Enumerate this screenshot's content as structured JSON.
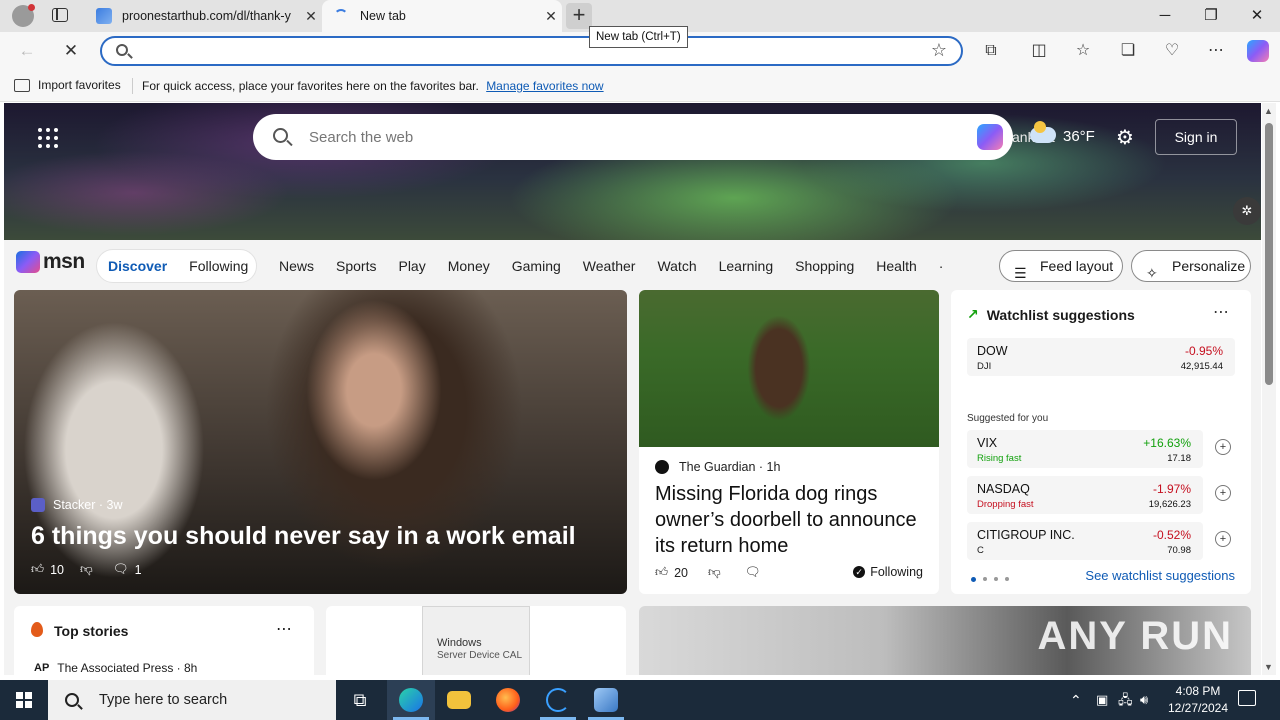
{
  "browser": {
    "tabs": [
      {
        "title": "proonestarthub.com/dl/thank-y",
        "close": "✕"
      },
      {
        "title": "New tab",
        "close": "✕"
      }
    ],
    "new_tab_tooltip": "New tab (Ctrl+T)",
    "address_value": "",
    "window_buttons": {
      "minimize": "─",
      "maximize": "❐",
      "close": "✕"
    }
  },
  "favorites_bar": {
    "import_label": "Import favorites",
    "message": "For quick access, place your favorites here on the favorites bar.",
    "manage_link": "Manage favorites now"
  },
  "msn": {
    "search_placeholder": "Search the web",
    "location": "ankfurt",
    "temperature": "36°F",
    "sign_in": "Sign in",
    "logo": "msn",
    "feed_tabs": {
      "discover": "Discover",
      "following": "Following"
    },
    "nav": [
      "News",
      "Sports",
      "Play",
      "Money",
      "Gaming",
      "Weather",
      "Watch",
      "Learning",
      "Shopping",
      "Health",
      "·"
    ],
    "feed_layout": "Feed layout",
    "personalize": "Personalize"
  },
  "cards": {
    "main": {
      "source": "Stacker",
      "age": "· 3w",
      "headline": "6 things you should never say in a work email",
      "likes": "10",
      "comments": "1"
    },
    "dog": {
      "source": "The Guardian",
      "age": "· 1h",
      "headline": "Missing Florida dog rings owner’s doorbell to announce its return home",
      "likes": "20",
      "following": "Following"
    },
    "watchlist": {
      "title": "Watchlist suggestions",
      "main_stock": {
        "name": "DOW",
        "ticker": "DJI",
        "change": "-0.95%",
        "value": "42,915.44"
      },
      "suggested_label": "Suggested for you",
      "suggested": [
        {
          "name": "VIX",
          "sub": "Rising fast",
          "change": "+16.63%",
          "value": "17.18"
        },
        {
          "name": "NASDAQ",
          "sub": "Dropping fast",
          "change": "-1.97%",
          "value": "19,626.23"
        },
        {
          "name": "CITIGROUP INC.",
          "sub": "C",
          "change": "-0.52%",
          "value": "70.98"
        }
      ],
      "see_more": "See watchlist suggestions"
    },
    "top_stories": {
      "title": "Top stories",
      "source": "The Associated Press · 8h",
      "source_logo": "AP"
    },
    "windows_box": {
      "line1": "Windows",
      "line2": "Server Device CAL"
    },
    "photo_watermark": "ANY RUN"
  },
  "taskbar": {
    "search_placeholder": "Type here to search",
    "time": "4:08 PM",
    "date": "12/27/2024"
  }
}
